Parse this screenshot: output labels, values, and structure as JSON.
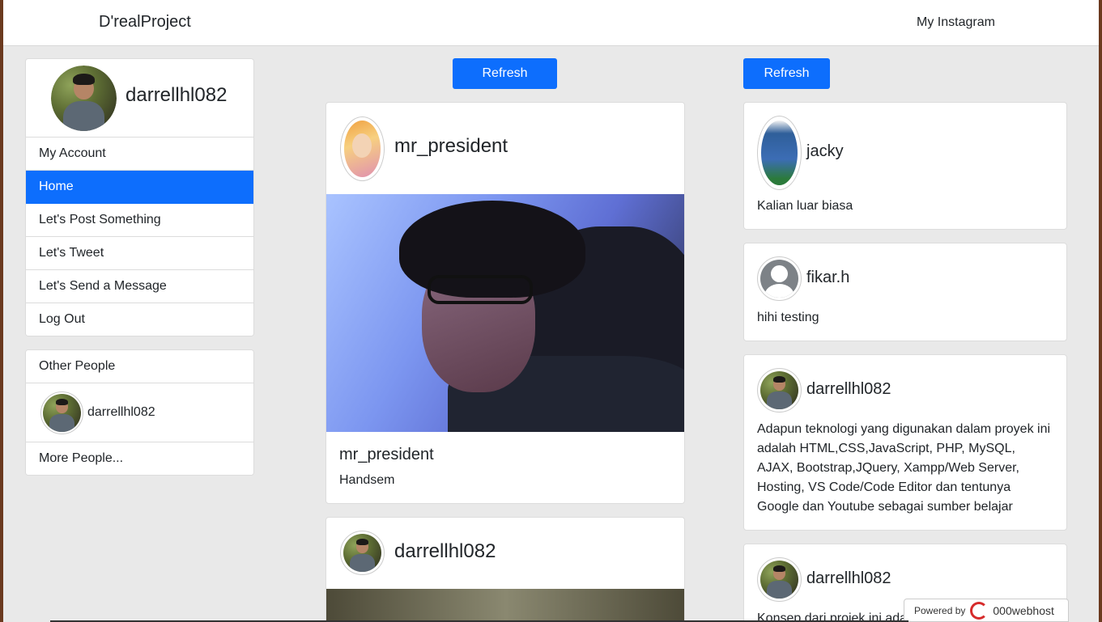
{
  "navbar": {
    "brand": "D'realProject",
    "link": "My Instagram"
  },
  "profile": {
    "username": "darrellhl082",
    "menu": [
      {
        "label": "My Account",
        "active": false
      },
      {
        "label": "Home",
        "active": true
      },
      {
        "label": "Let's Post Something",
        "active": false
      },
      {
        "label": "Let's Tweet",
        "active": false
      },
      {
        "label": "Let's Send a Message",
        "active": false
      },
      {
        "label": "Log Out",
        "active": false
      }
    ]
  },
  "people": {
    "header": "Other People",
    "items": [
      {
        "username": "darrellhl082"
      }
    ],
    "more": "More People..."
  },
  "feed": {
    "refresh_label": "Refresh",
    "posts": [
      {
        "author": "mr_president",
        "caption_author": "mr_president",
        "caption": "Handsem"
      },
      {
        "author": "darrellhl082"
      }
    ]
  },
  "tweets": {
    "refresh_label": "Refresh",
    "items": [
      {
        "author": "jacky",
        "text": "Kalian luar biasa"
      },
      {
        "author": "fikar.h",
        "text": "hihi testing"
      },
      {
        "author": "darrellhl082",
        "text": "Adapun teknologi yang digunakan dalam proyek ini adalah HTML,CSS,JavaScript, PHP, MySQL, AJAX, Bootstrap,JQuery, Xampp/Web Server, Hosting, VS Code/Code Editor dan tentunya Google dan Youtube sebagai sumber belajar"
      },
      {
        "author": "darrellhl082",
        "text": "Konsep dari projek ini adalah meniru Instagram dan"
      }
    ]
  },
  "footer_badge": {
    "prefix": "Powered by",
    "brand": "000webhost"
  },
  "colors": {
    "primary": "#0d6efd",
    "background": "#e9e9e9"
  }
}
